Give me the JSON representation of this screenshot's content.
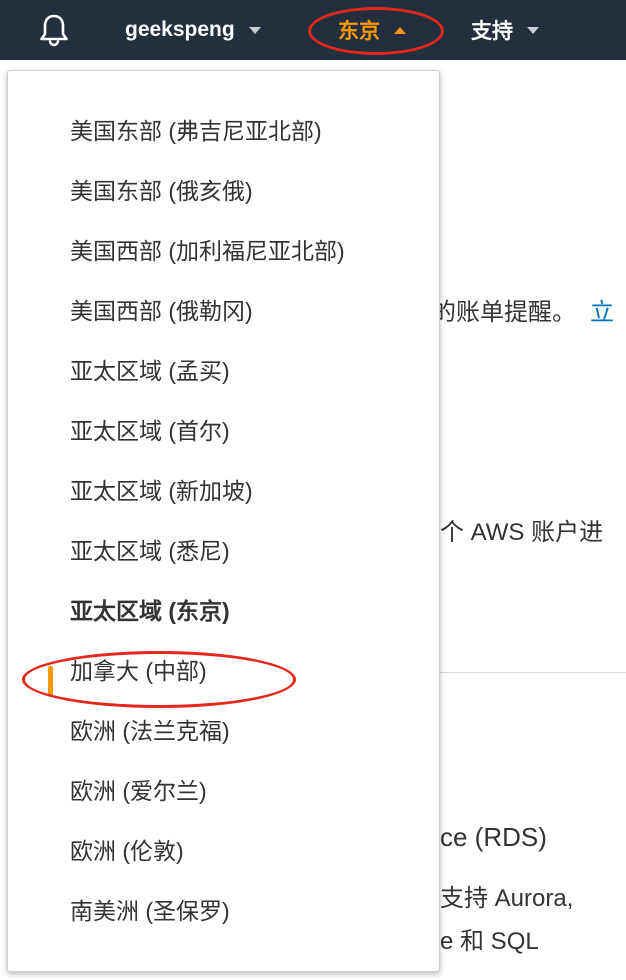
{
  "topbar": {
    "user_label": "geekspeng",
    "region_label": "东京",
    "support_label": "支持",
    "colors": {
      "bar": "#232f3e",
      "region_text": "#ff9900",
      "annotation": "#e4291c"
    }
  },
  "background": {
    "line1": "的账单提醒。",
    "line1_link": "立",
    "line2": "个 AWS 账户进",
    "line3": "ce (RDS)",
    "line4": "支持 Aurora,",
    "line5": "e 和 SQL"
  },
  "region_menu": {
    "items": [
      "美国东部 (弗吉尼亚北部)",
      "美国东部 (俄亥俄)",
      "美国西部 (加利福尼亚北部)",
      "美国西部 (俄勒冈)",
      "亚太区域 (孟买)",
      "亚太区域 (首尔)",
      "亚太区域 (新加坡)",
      "亚太区域 (悉尼)",
      "亚太区域 (东京)",
      "加拿大 (中部)",
      "欧洲 (法兰克福)",
      "欧洲 (爱尔兰)",
      "欧洲 (伦敦)",
      "南美洲 (圣保罗)"
    ],
    "selected": "亚太区域 (东京)"
  }
}
